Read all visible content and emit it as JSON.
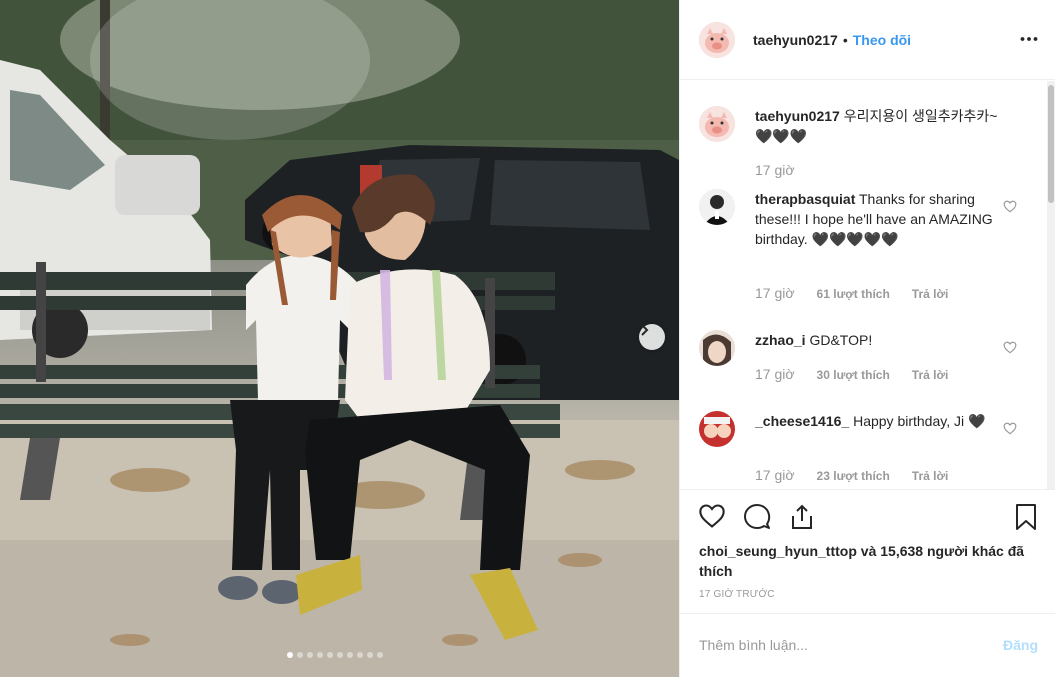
{
  "post": {
    "author": "taehyun0217",
    "separator": "•",
    "follow_label": "Theo dõi",
    "more_icon": "more-horizontal-icon",
    "carousel": {
      "total_slides": 10,
      "active_slide": 1
    }
  },
  "comments": [
    {
      "user": "taehyun0217",
      "text": " 우리지용이 생일추카추카~🖤🖤🖤",
      "time": "17 giờ",
      "likes": "",
      "reply": ""
    },
    {
      "user": "therapbasquiat",
      "text": " Thanks for sharing these!!! I hope he'll have an AMAZING birthday. 🖤🖤🖤🖤🖤",
      "time": "17 giờ",
      "likes": "61 lượt thích",
      "reply": "Trả lời"
    },
    {
      "user": "zzhao_i",
      "text": " GD&TOP!",
      "time": "17 giờ",
      "likes": "30 lượt thích",
      "reply": "Trả lời"
    },
    {
      "user": "_cheese1416_",
      "text": " Happy birthday, Ji 🖤",
      "time": "17 giờ",
      "likes": "23 lượt thích",
      "reply": "Trả lời"
    }
  ],
  "actions": {
    "like_icon": "heart-icon",
    "comment_icon": "comment-bubble-icon",
    "share_icon": "share-icon",
    "save_icon": "bookmark-icon",
    "likes_text": "choi_seung_hyun_tttop và 15,638 người khác đã thích",
    "timestamp": "17 GIỜ TRƯỚC"
  },
  "add_comment": {
    "placeholder": "Thêm bình luận...",
    "post_label": "Đăng"
  },
  "colors": {
    "link": "#3897f0",
    "muted": "#999999",
    "post_disabled": "#b2dffc",
    "border": "#efefef"
  }
}
